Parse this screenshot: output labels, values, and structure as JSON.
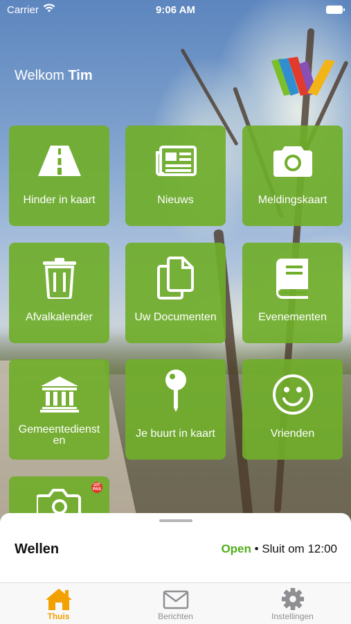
{
  "status_bar": {
    "carrier": "Carrier",
    "time": "9:06 AM"
  },
  "header": {
    "greeting": "Welkom",
    "user_name": "Tim"
  },
  "tiles": [
    {
      "label": "Hinder in kaart",
      "icon": "road-icon"
    },
    {
      "label": "Nieuws",
      "icon": "newspaper-icon"
    },
    {
      "label": "Meldingskaart",
      "icon": "camera-icon"
    },
    {
      "label": "Afvalkalender",
      "icon": "trash-icon"
    },
    {
      "label": "Uw Documenten",
      "icon": "documents-icon"
    },
    {
      "label": "Evenementen",
      "icon": "book-icon"
    },
    {
      "label": "Gemeentedienst\nen",
      "icon": "building-icon"
    },
    {
      "label": "Je buurt in kaart",
      "icon": "map-pin-icon"
    },
    {
      "label": "Vrienden",
      "icon": "smiley-icon"
    },
    {
      "label": "",
      "icon": "photo-icon",
      "badge": "UiT\nPAS"
    }
  ],
  "location_sheet": {
    "title": "Wellen",
    "status": "Open",
    "separator": " • ",
    "closing": "Sluit om 12:00"
  },
  "tab_bar": [
    {
      "label": "Thuis",
      "icon": "home-icon",
      "active": true
    },
    {
      "label": "Berichten",
      "icon": "envelope-icon",
      "active": false
    },
    {
      "label": "Instellingen",
      "icon": "gear-icon",
      "active": false
    }
  ],
  "colors": {
    "tile_green": "#70ae2a",
    "open_green": "#4fae1a",
    "active_tab": "#f2a100",
    "inactive_tab": "#8e8e93"
  }
}
